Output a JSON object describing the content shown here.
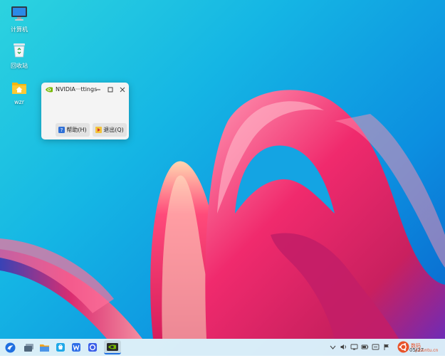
{
  "desktop": {
    "icons": [
      {
        "label": "计算机",
        "icon": "computer-icon"
      },
      {
        "label": "回收站",
        "icon": "recycle-bin-icon"
      },
      {
        "label": "wzr",
        "icon": "home-folder-icon"
      }
    ]
  },
  "dialog": {
    "title": "NVIDIA···ttings",
    "help_label": "帮助(H)",
    "quit_label": "退出(Q)",
    "icon": "nvidia-icon"
  },
  "taskbar": {
    "start_icon": "start-menu-icon",
    "apps": [
      "multitask-view-icon",
      "file-manager-icon",
      "software-store-icon",
      "wps-writer-icon",
      "browser-icon",
      "nvidia-settings-icon"
    ],
    "tray": [
      "keyboard-icon",
      "volume-icon",
      "network-icon",
      "battery-icon",
      "notification-icon",
      "flag-icon"
    ],
    "clock_date": "05/27",
    "watermark_main": "数码",
    "watermark_site": "/ubuntu.cn"
  },
  "colors": {
    "accent_blue": "#1f6fe0",
    "brand_orange": "#e8532a",
    "nvidia_green": "#76b900"
  }
}
